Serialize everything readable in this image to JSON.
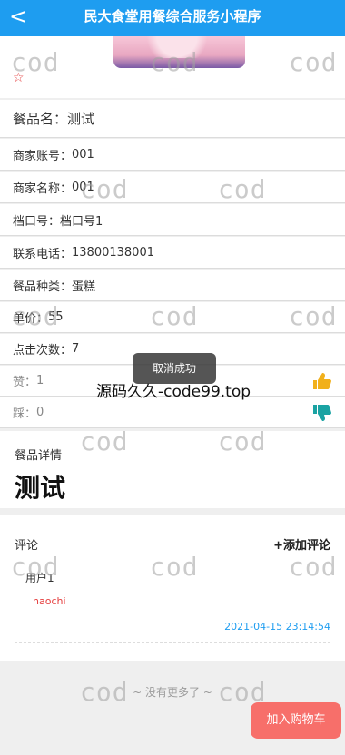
{
  "header": {
    "back": "<",
    "title": "民大食堂用餐综合服务小程序"
  },
  "favorite_icon": "star-outline",
  "info": {
    "name_label": "餐品名：",
    "name_value": "测试",
    "merchant_account_label": "商家账号：",
    "merchant_account_value": "001",
    "merchant_name_label": "商家名称：",
    "merchant_name_value": "001",
    "stall_label": "档口号：",
    "stall_value": "档口号1",
    "phone_label": "联系电话：",
    "phone_value": "13800138001",
    "category_label": "餐品种类：",
    "category_value": "蛋糕",
    "price_label": "单价：",
    "price_value": "55",
    "clicks_label": "点击次数：",
    "clicks_value": "7",
    "like_label": "赞：",
    "like_value": "1",
    "dislike_label": "踩：",
    "dislike_value": "0"
  },
  "detail": {
    "label": "餐品详情",
    "value": "测试"
  },
  "comments": {
    "title": "评论",
    "add_label": "+添加评论",
    "items": [
      {
        "user": "用户1",
        "text": "haochi",
        "time": "2021-04-15 23:14:54"
      }
    ]
  },
  "no_more": "~ 没有更多了 ~",
  "cart_button": "加入购物车",
  "toast": "取消成功",
  "overlay_text": "源码久久-code99.top",
  "watermark": "cod",
  "colors": {
    "header": "#1e9df0",
    "cart": "#f76f6a",
    "like": "#f1b01b",
    "dislike": "#1aa3a3",
    "comment_text": "#e53e3e",
    "time": "#1e9df0"
  }
}
